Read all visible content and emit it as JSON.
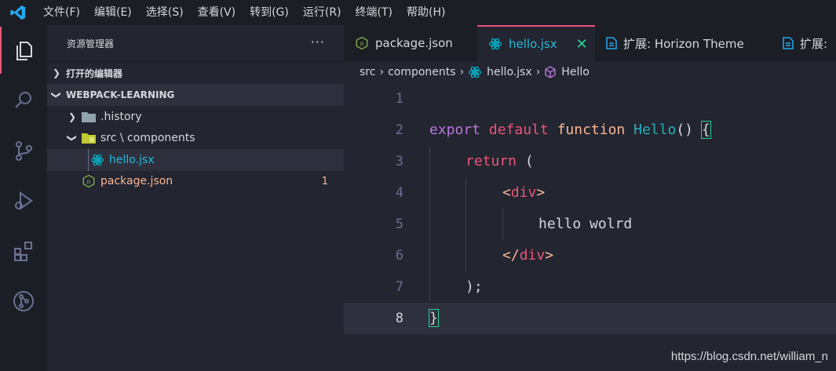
{
  "menu": [
    "文件(F)",
    "编辑(E)",
    "选择(S)",
    "查看(V)",
    "转到(G)",
    "运行(R)",
    "终端(T)",
    "帮助(H)"
  ],
  "sidebar": {
    "title": "资源管理器",
    "more": "···",
    "open_editors": "打开的编辑器",
    "project": "WEBPACK-LEARNING",
    "tree": {
      "history": ".history",
      "src_folder": "src \\ components",
      "hello_file": "hello.jsx",
      "package_file": "package.json",
      "package_badge": "1"
    }
  },
  "tabs": [
    {
      "label": "package.json",
      "icon": "nodejs-icon"
    },
    {
      "label": "hello.jsx",
      "icon": "react-icon",
      "close": "✕"
    },
    {
      "label": "扩展: Horizon Theme",
      "icon": "file-icon"
    },
    {
      "label": "扩展:",
      "icon": "file-icon"
    }
  ],
  "breadcrumb": {
    "src": "src",
    "components": "components",
    "file": "hello.jsx",
    "symbol": "Hello"
  },
  "code": {
    "line_numbers": [
      "1",
      "2",
      "3",
      "4",
      "5",
      "6",
      "7",
      "8"
    ],
    "l2_export": "export",
    "l2_default": "default",
    "l2_function": "function",
    "l2_name": "Hello",
    "l2_paren": "()",
    "l2_brace": "{",
    "l3_return": "return",
    "l3_paren": "(",
    "l4_open_lt": "<",
    "l4_tag": "div",
    "l4_gt": ">",
    "l5_text": "hello wolrd",
    "l6_open": "</",
    "l6_tag": "div",
    "l6_gt": ">",
    "l7_text": ");",
    "l8_brace": "}"
  },
  "watermark": "https://blog.csdn.net/william_n",
  "colors": {
    "accent": "#e95678",
    "background": "#1c1e26",
    "editor": "#232530",
    "keyword_purple": "#b877db",
    "function_orange": "#fab795",
    "name_cyan": "#25b0bc",
    "match_green": "#29d398"
  }
}
